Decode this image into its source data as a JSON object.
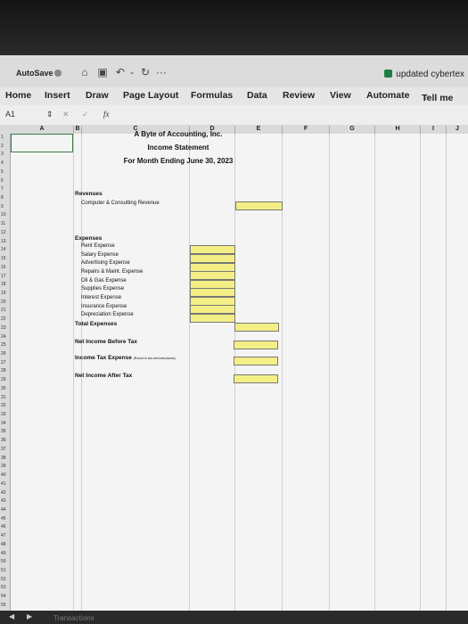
{
  "titlebar": {
    "autosave_label": "AutoSave",
    "more_label": "···",
    "document_title": "updated cybertex"
  },
  "ribbon": {
    "tabs": [
      "Home",
      "Insert",
      "Draw",
      "Page Layout",
      "Formulas",
      "Data",
      "Review",
      "View",
      "Automate"
    ],
    "tell_me": "Tell me"
  },
  "formula_bar": {
    "name_box": "A1",
    "fx_label": "fx",
    "value": ""
  },
  "columns": [
    "A",
    "B",
    "C",
    "D",
    "E",
    "F",
    "G",
    "H",
    "I",
    "J"
  ],
  "rows": [
    "1",
    "2",
    "3",
    "4",
    "5",
    "6",
    "7",
    "8",
    "9",
    "10",
    "11",
    "12",
    "13",
    "14",
    "15",
    "16",
    "17",
    "18",
    "19",
    "20",
    "21",
    "22",
    "23",
    "24",
    "25",
    "26",
    "27",
    "28",
    "29",
    "30",
    "31",
    "32",
    "33",
    "34",
    "35",
    "36",
    "37",
    "38",
    "39",
    "40",
    "41",
    "42",
    "43",
    "44",
    "45",
    "46",
    "47",
    "48",
    "49",
    "50",
    "51",
    "52",
    "53",
    "54",
    "55"
  ],
  "sheet": {
    "company": "A Byte of Accounting, Inc.",
    "statement": "Income Statement",
    "period": "For Month Ending June 30, 2023",
    "revenues_label": "Revenues",
    "revenue_item": "Computer & Consulting Revenue",
    "expenses_label": "Expenses",
    "expense_items": [
      "Rent Expense",
      "Salary Expense",
      "Advertising Expense",
      "Repairs & Maint. Expense",
      "Oil & Gas Expense",
      "Supplies Expense",
      "Interest Expense",
      "Insurance Expense",
      "Depreciation Expense"
    ],
    "total_expenses": "Total Expenses",
    "net_income_before_tax": "Net Income Before Tax",
    "income_tax_expense": "Income Tax Expense",
    "income_tax_note": "(Round to two decimal places)",
    "net_income_after_tax": "Net Income After Tax"
  },
  "sheet_tab": "Transactions",
  "colors": {
    "input_cell": "#f3ef86",
    "ribbon": "#e6e6e6",
    "grid": "#f4f4f4"
  }
}
